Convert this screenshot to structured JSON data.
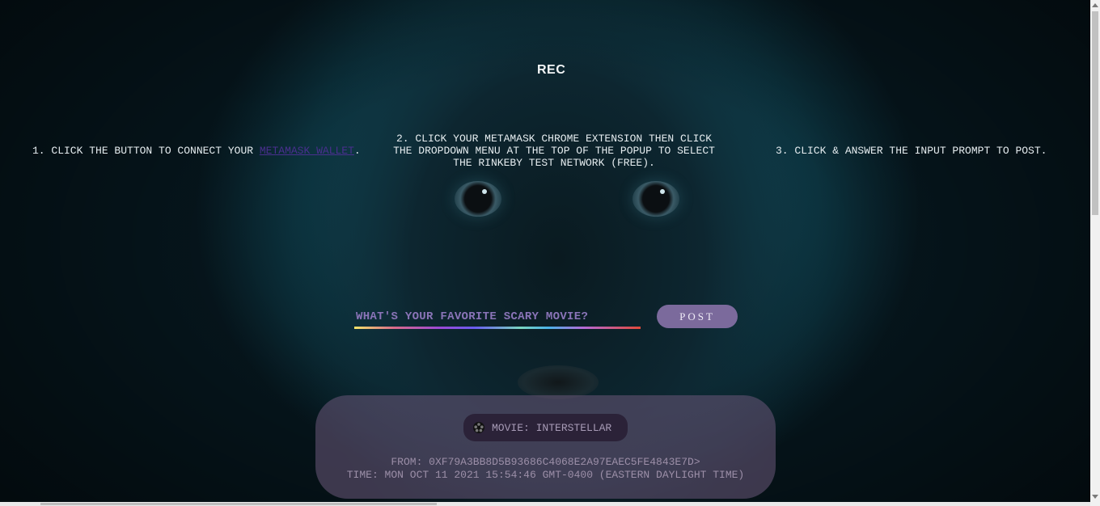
{
  "header": {
    "title": "REC"
  },
  "instructions": {
    "step1_prefix": "1. CLICK THE BUTTON TO CONNECT YOUR ",
    "step1_link": "METAMASK WALLET",
    "step1_suffix": ".",
    "step2": "2. CLICK YOUR METAMASK CHROME EXTENSION THEN CLICK THE DROPDOWN MENU AT THE TOP OF THE POPUP TO SELECT THE RINKEBY TEST NETWORK (FREE).",
    "step3": "3. CLICK & ANSWER THE INPUT PROMPT TO POST."
  },
  "form": {
    "input_placeholder": "WHAT'S YOUR FAVORITE SCARY MOVIE?",
    "input_value": "",
    "post_label": "POST"
  },
  "post_card": {
    "movie_icon": "film-reel-icon",
    "movie_text": "MOVIE: INTERSTELLAR",
    "from": "FROM: 0XF79A3BB8D5B93686C4068E2A97EAEC5FE4843E7D>",
    "time": "TIME: MON OCT 11 2021 15:54:46 GMT-0400 (EASTERN DAYLIGHT TIME)"
  },
  "colors": {
    "background": "#0f4250",
    "link": "#4a2f8f",
    "post_button": "#7b6a9c",
    "card": "#665476",
    "badge": "#2b2238"
  }
}
